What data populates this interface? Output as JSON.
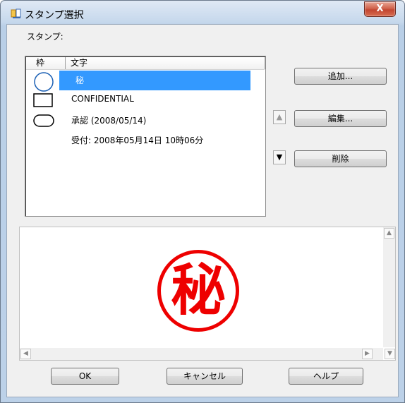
{
  "window": {
    "title": "スタンプ選択",
    "close_label": "X"
  },
  "stamp_label": "スタンプ:",
  "list": {
    "columns": [
      "枠",
      "文字"
    ],
    "rows": [
      {
        "frame": "circle",
        "text": "秘",
        "selected": true
      },
      {
        "frame": "rectangle",
        "text": "CONFIDENTIAL",
        "selected": false
      },
      {
        "frame": "rounded-rectangle",
        "text": "承認 (2008/05/14)",
        "selected": false
      },
      {
        "frame": "none",
        "text": "受付: 2008年05月14日 10時06分",
        "selected": false
      }
    ]
  },
  "buttons": {
    "add": "追加...",
    "edit": "編集...",
    "delete": "削除",
    "ok": "OK",
    "cancel": "キャンセル",
    "help": "ヘルプ"
  },
  "move": {
    "up": "▲",
    "down": "▼"
  },
  "preview": {
    "stamp_text": "秘",
    "stamp_color": "#ee0000"
  },
  "colors": {
    "selection": "#3399ff",
    "close_button": "#c24530"
  }
}
